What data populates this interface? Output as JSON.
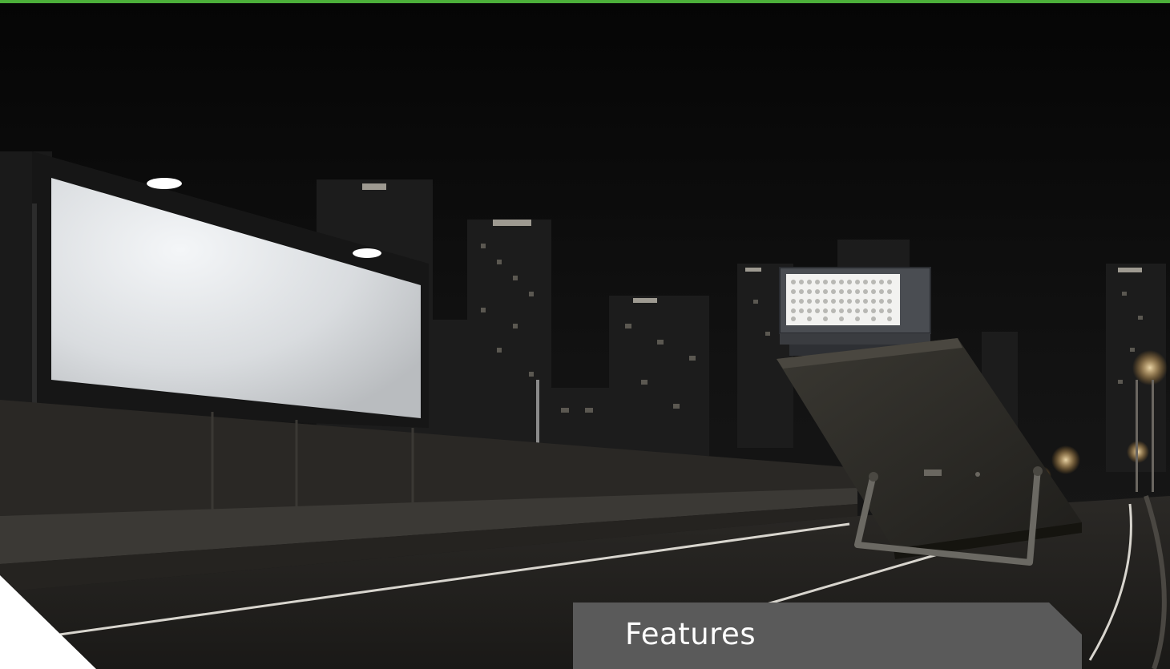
{
  "page": {
    "top_bar_color": "#4caf3a"
  },
  "hero": {
    "image_description_icon": "highway-billboard-night-photo",
    "product_icon": "led-flood-light-icon"
  },
  "features_tab": {
    "title": "Features",
    "background_color": "#5a5a5a"
  },
  "corner": {
    "color": "#ffffff"
  }
}
